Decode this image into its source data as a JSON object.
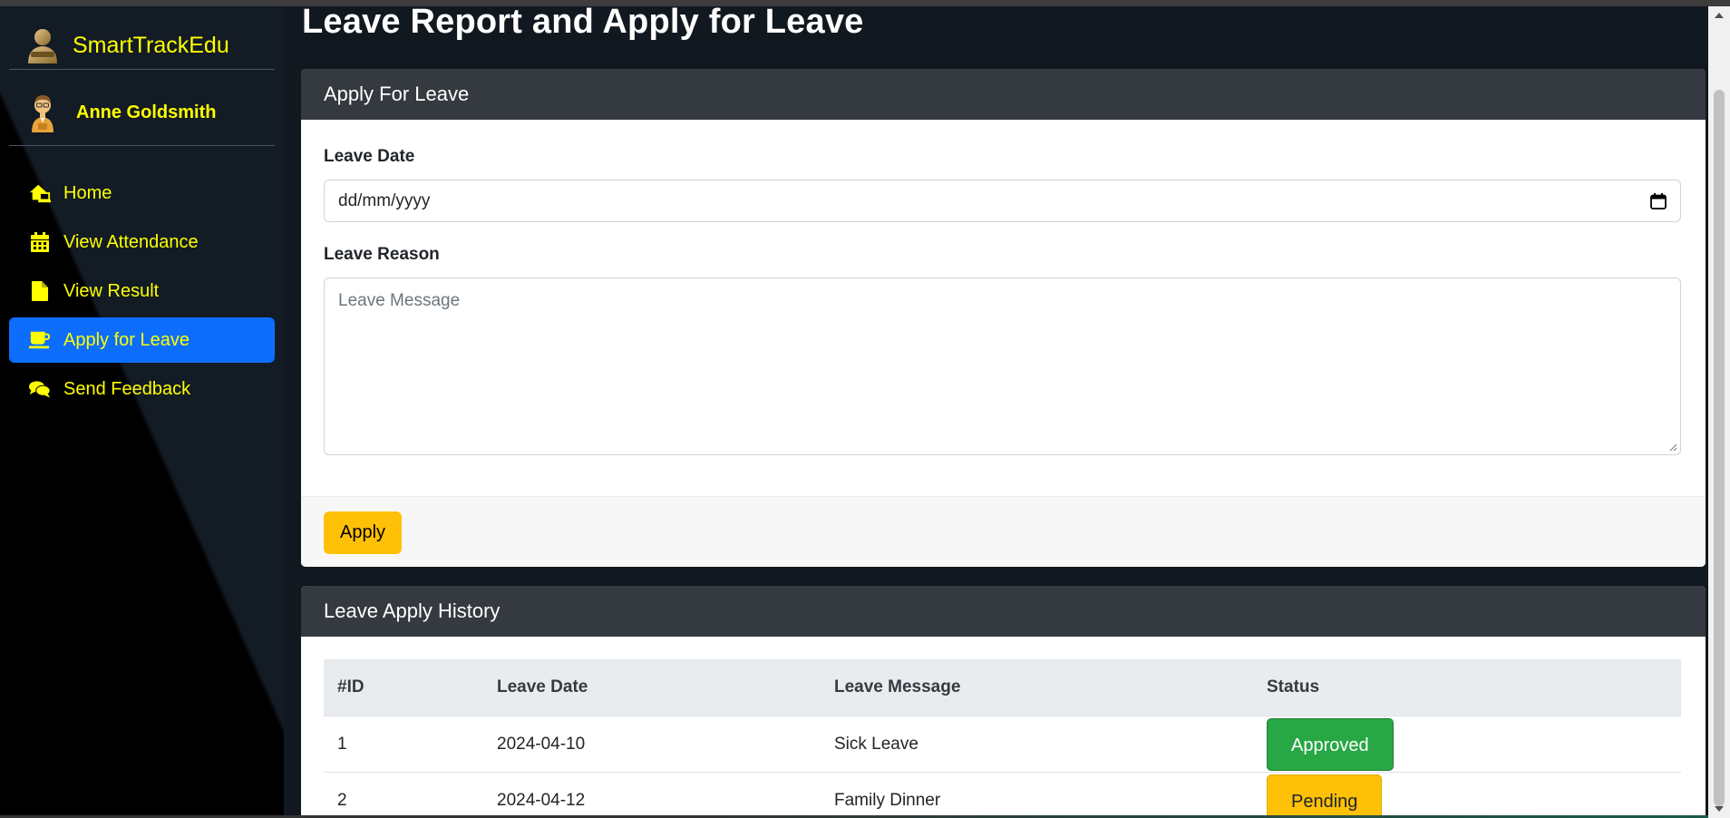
{
  "brand": {
    "name": "SmartTrackEdu",
    "logo_icon": "user-silhouette-icon"
  },
  "user": {
    "name": "Anne Goldsmith",
    "avatar_icon": "student-avatar-icon"
  },
  "sidebar": {
    "items": [
      {
        "label": "Home",
        "icon": "home-laptop-icon",
        "active": false
      },
      {
        "label": "View Attendance",
        "icon": "calendar-icon",
        "active": false
      },
      {
        "label": "View Result",
        "icon": "file-icon",
        "active": false
      },
      {
        "label": "Apply for Leave",
        "icon": "mug-icon",
        "active": true
      },
      {
        "label": "Send Feedback",
        "icon": "comments-icon",
        "active": false
      }
    ]
  },
  "page": {
    "title": "Leave Report and Apply for Leave"
  },
  "apply_form": {
    "header": "Apply For Leave",
    "date_label": "Leave Date",
    "date_placeholder": "dd/mm/yyyy",
    "reason_label": "Leave Reason",
    "reason_placeholder": "Leave Message",
    "apply_label": "Apply"
  },
  "history": {
    "header": "Leave Apply History",
    "columns": [
      "#ID",
      "Leave Date",
      "Leave Message",
      "Status"
    ],
    "rows": [
      {
        "id": "1",
        "date": "2024-04-10",
        "message": "Sick Leave",
        "status": "Approved"
      },
      {
        "id": "2",
        "date": "2024-04-12",
        "message": "Family Dinner",
        "status": "Pending"
      }
    ]
  },
  "colors": {
    "accent_yellow": "#ffff00",
    "active_nav": "#0d6efd",
    "apply_button": "#ffc107",
    "approved": "#28a745",
    "pending": "#ffc107",
    "card_header": "#343a40"
  }
}
